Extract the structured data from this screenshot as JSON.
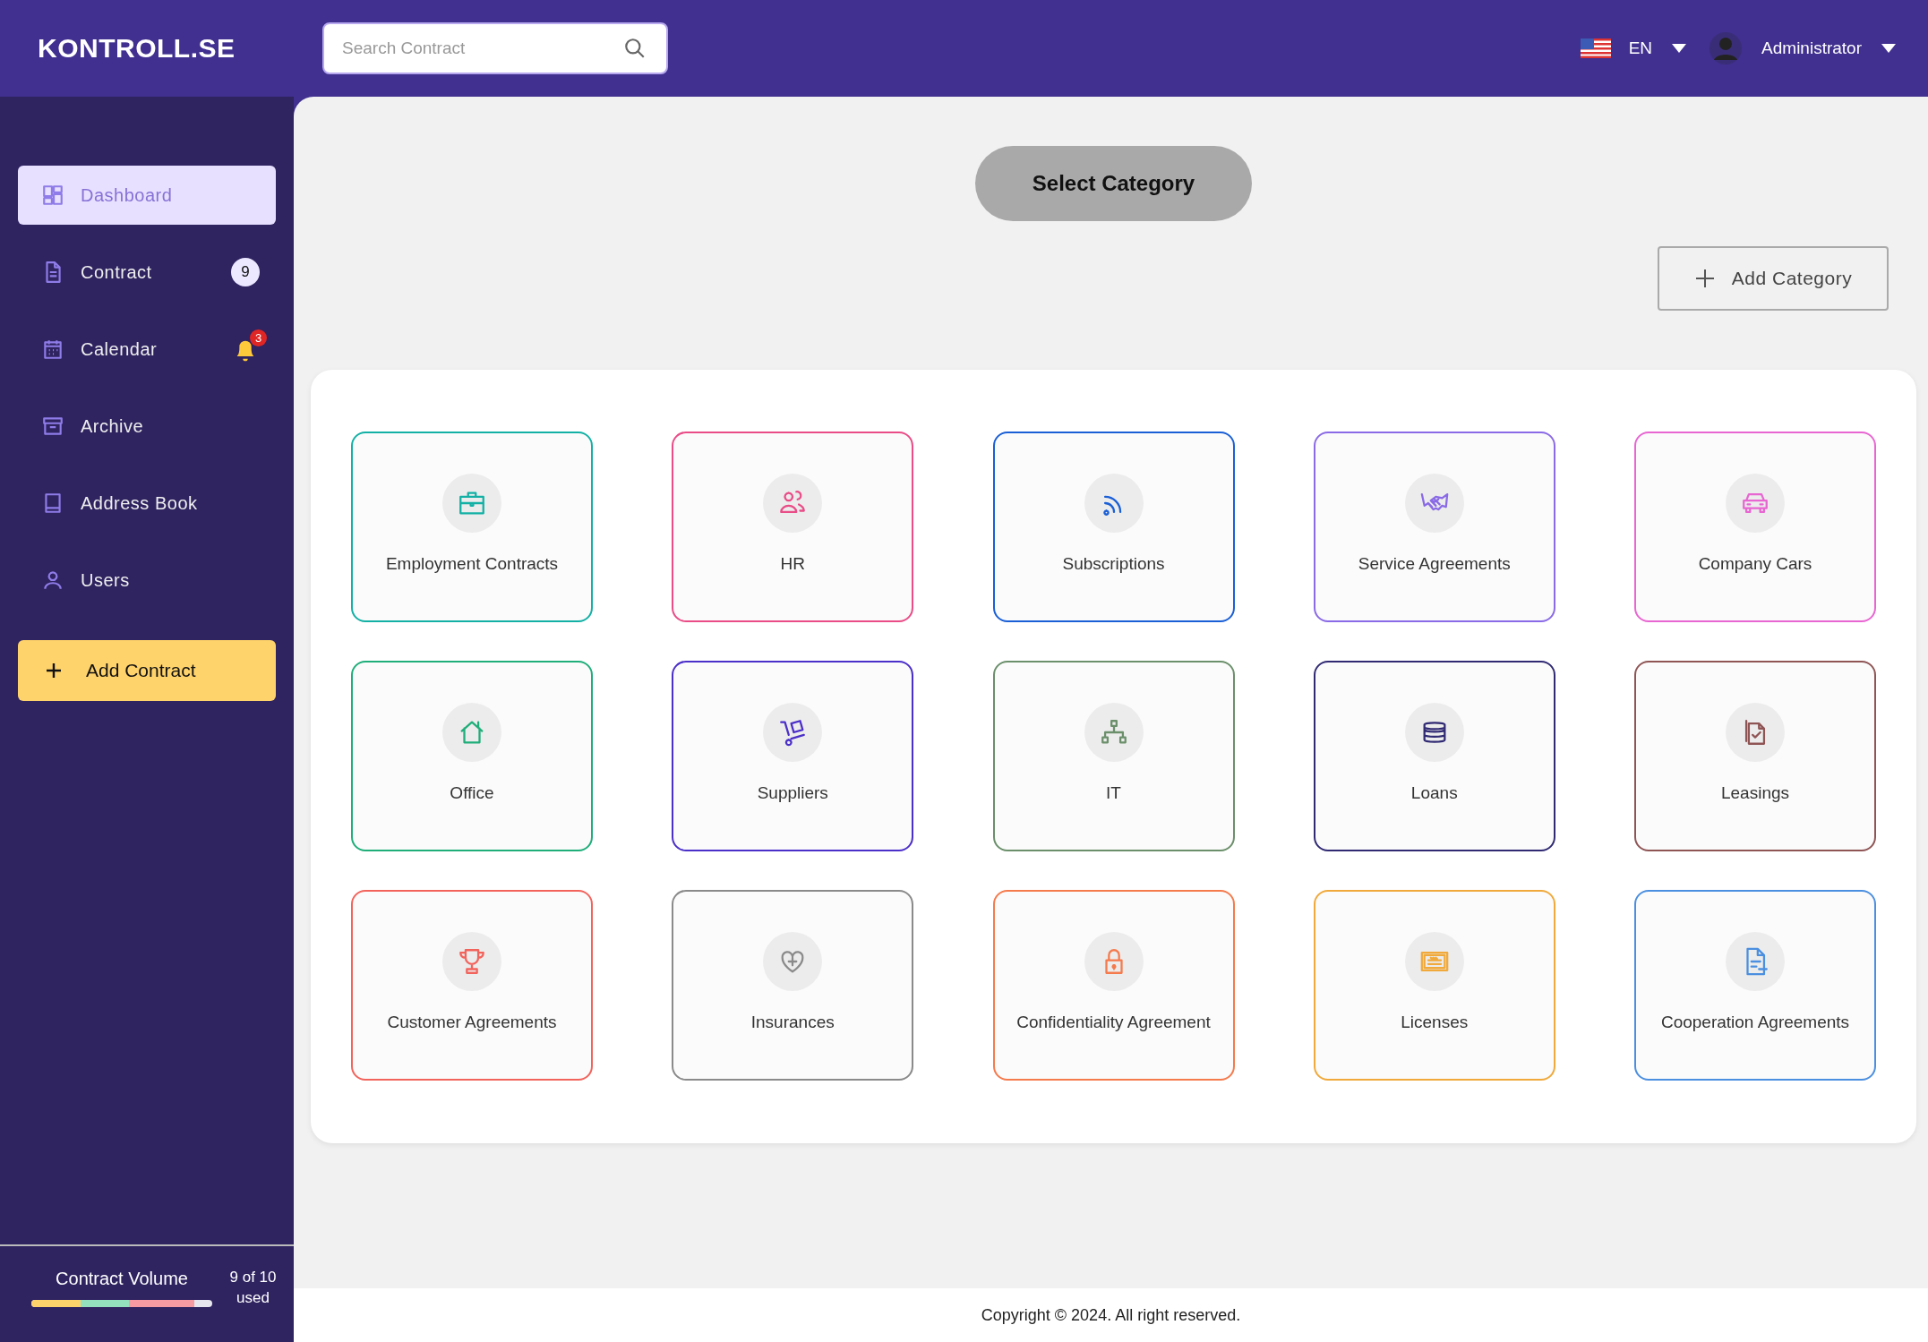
{
  "header": {
    "logo": "KONTROLL.SE",
    "search": {
      "placeholder": "Search Contract"
    },
    "language": "EN",
    "user": "Administrator"
  },
  "sidebar": {
    "items": [
      {
        "label": "Dashboard",
        "selected": true
      },
      {
        "label": "Contract",
        "selected": false,
        "badge": {
          "kind": "count",
          "text": "9"
        }
      },
      {
        "label": "Calendar",
        "selected": false,
        "badge": {
          "kind": "bell",
          "text": "3"
        }
      },
      {
        "label": "Archive",
        "selected": false
      },
      {
        "label": "Address Book",
        "selected": false
      },
      {
        "label": "Users",
        "selected": false
      }
    ],
    "add_button": "Add Contract",
    "volume": {
      "label": "Contract Volume",
      "reading": "9 of 10 used",
      "level": 0.9
    }
  },
  "main": {
    "heading": "Select Category",
    "add_button": "Add Category",
    "categories": [
      {
        "label": "Employment Contracts",
        "color": "#13b0a5"
      },
      {
        "label": "HR",
        "color": "#e94c86"
      },
      {
        "label": "Subscriptions",
        "color": "#1a5fd6"
      },
      {
        "label": "Service Agreements",
        "color": "#8a6ae6"
      },
      {
        "label": "Company Cars",
        "color": "#e866d2"
      },
      {
        "label": "Office",
        "color": "#1fae7a"
      },
      {
        "label": "Suppliers",
        "color": "#4b2fc9"
      },
      {
        "label": "IT",
        "color": "#6b8f6b"
      },
      {
        "label": "Loans",
        "color": "#302a73"
      },
      {
        "label": "Leasings",
        "color": "#8f5555"
      },
      {
        "label": "Customer Agreements",
        "color": "#f2635c"
      },
      {
        "label": "Insurances",
        "color": "#8a8a8a"
      },
      {
        "label": "Confidentiality Agreement",
        "color": "#f57a4c"
      },
      {
        "label": "Licenses",
        "color": "#f0a93a"
      },
      {
        "label": "Cooperation Agreements",
        "color": "#4b8fe0"
      }
    ]
  },
  "footer": {
    "copyright": "Copyright © 2024. All right reserved."
  }
}
